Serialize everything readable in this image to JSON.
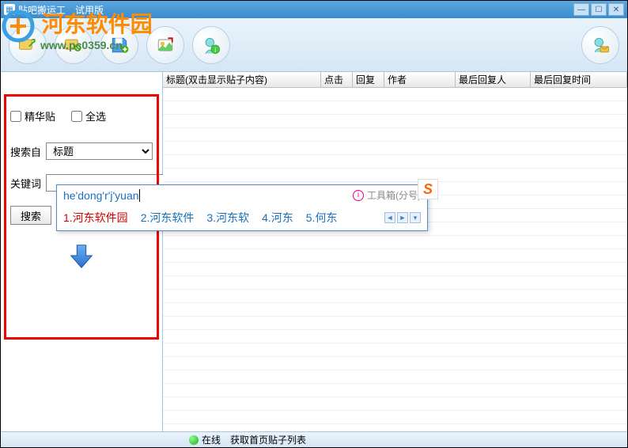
{
  "titlebar": {
    "title": "贴吧搬运工",
    "subtitle": "试用版"
  },
  "watermark": {
    "text": "河东软件园",
    "url": "www.pc0359.cn"
  },
  "sidebar": {
    "checkbox1": "精华贴",
    "checkbox2": "全选",
    "search_from_label": "搜索自",
    "search_from_value": "标题",
    "keyword_label": "关键词",
    "keyword_value": "",
    "search_btn": "搜索"
  },
  "table": {
    "headers": {
      "title": "标题(双击显示贴子内容)",
      "clicks": "点击",
      "replies": "回复",
      "author": "作者",
      "last_replier": "最后回复人",
      "last_reply_time": "最后回复时间"
    }
  },
  "status": {
    "online": "在线",
    "action": "获取首页贴子列表"
  },
  "ime": {
    "input": "he'dong'r'j'yuan",
    "info": "工具箱(分号)",
    "candidates": [
      {
        "num": "1.",
        "text": "河东软件园"
      },
      {
        "num": "2.",
        "text": "河东软件"
      },
      {
        "num": "3.",
        "text": "河东软"
      },
      {
        "num": "4.",
        "text": "河东"
      },
      {
        "num": "5.",
        "text": "何东"
      }
    ]
  }
}
